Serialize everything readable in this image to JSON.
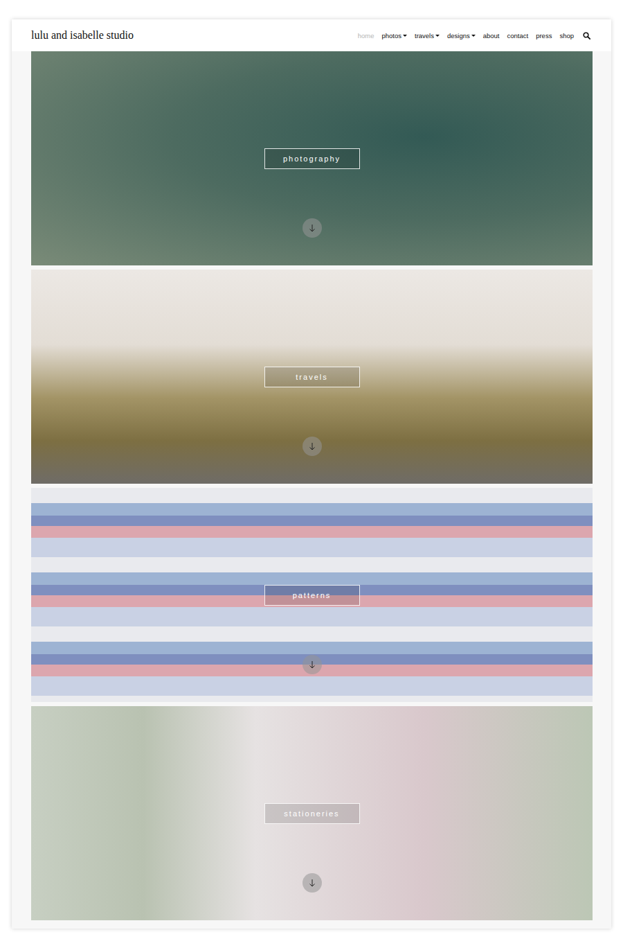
{
  "site": {
    "title": "lulu and isabelle studio"
  },
  "nav": [
    {
      "label": "home",
      "selected": true,
      "dropdown": false
    },
    {
      "label": "photos",
      "selected": false,
      "dropdown": true
    },
    {
      "label": "travels",
      "selected": false,
      "dropdown": true
    },
    {
      "label": "designs",
      "selected": false,
      "dropdown": true
    },
    {
      "label": "about",
      "selected": false,
      "dropdown": false
    },
    {
      "label": "contact",
      "selected": false,
      "dropdown": false
    },
    {
      "label": "press",
      "selected": false,
      "dropdown": false
    },
    {
      "label": "shop",
      "selected": false,
      "dropdown": false
    }
  ],
  "panels": [
    {
      "label": "photography",
      "kind": "photo"
    },
    {
      "label": "travels",
      "kind": "road"
    },
    {
      "label": "patterns",
      "kind": "pattern"
    },
    {
      "label": "stationeries",
      "kind": "paper"
    }
  ]
}
